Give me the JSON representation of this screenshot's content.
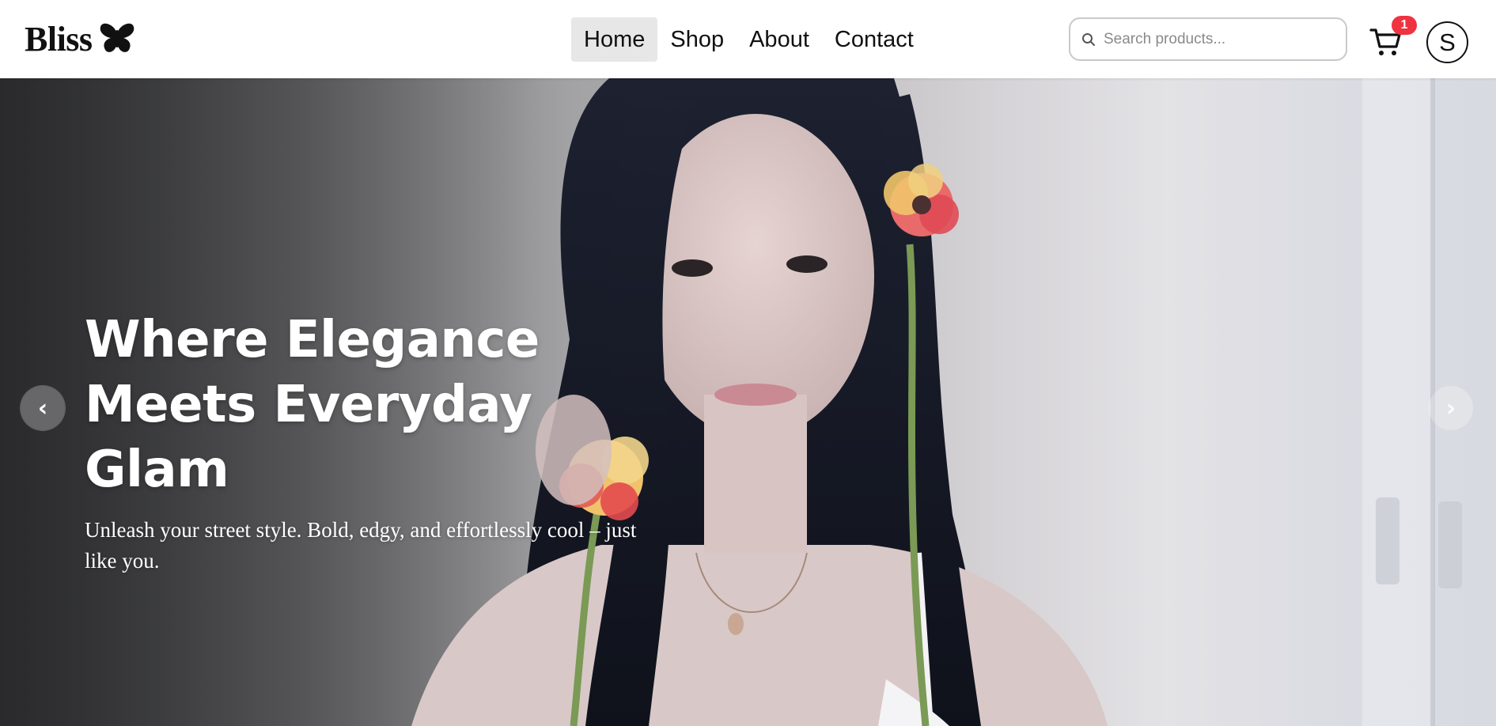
{
  "header": {
    "brand": "Bliss",
    "nav": [
      {
        "label": "Home",
        "active": true
      },
      {
        "label": "Shop",
        "active": false
      },
      {
        "label": "About",
        "active": false
      },
      {
        "label": "Contact",
        "active": false
      }
    ],
    "search": {
      "placeholder": "Search products...",
      "value": ""
    },
    "cart": {
      "count": "1"
    },
    "user": {
      "initial": "S"
    }
  },
  "hero": {
    "title_line1": "Where Elegance",
    "title_line2": "Meets Everyday Glam",
    "subtitle": "Unleash your street style. Bold, edgy, and effortlessly cool – just like you.",
    "prev_arrow": "‹",
    "next_arrow": "›"
  },
  "colors": {
    "badge": "#ef3340",
    "active_nav_bg": "#e7e7e7",
    "text": "#111111"
  },
  "icons": {
    "logo": "butterfly-icon",
    "search": "search-icon",
    "cart": "cart-icon"
  }
}
